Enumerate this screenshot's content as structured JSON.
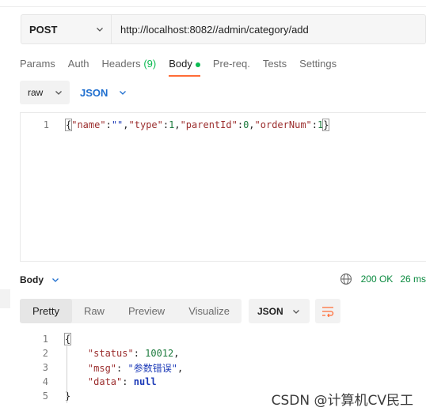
{
  "request": {
    "method": "POST",
    "url": "http://localhost:8082//admin/category/add"
  },
  "tabs": [
    {
      "label": "Params"
    },
    {
      "label": "Auth"
    },
    {
      "label": "Headers",
      "count": "(9)"
    },
    {
      "label": "Body"
    },
    {
      "label": "Pre-req."
    },
    {
      "label": "Tests"
    },
    {
      "label": "Settings"
    }
  ],
  "body_options": {
    "mode": "raw",
    "format": "JSON"
  },
  "editor": {
    "line_number": "1",
    "tokens": [
      "{",
      "\"name\"",
      ":",
      "\"\"",
      ",",
      "\"type\"",
      ":",
      "1",
      ",",
      "\"parentId\"",
      ":",
      "0",
      ",",
      "\"orderNum\"",
      ":",
      "1",
      "}"
    ]
  },
  "response": {
    "body_label": "Body",
    "status": "200 OK",
    "time": "26 ms",
    "view_tabs": [
      "Pretty",
      "Raw",
      "Preview",
      "Visualize"
    ],
    "format": "JSON",
    "lines": [
      {
        "n": "1",
        "text": "{"
      },
      {
        "n": "2",
        "key": "\"status\"",
        "value": "10012",
        "trail": ","
      },
      {
        "n": "3",
        "key": "\"msg\"",
        "value": "\"参数错误\"",
        "trail": ","
      },
      {
        "n": "4",
        "key": "\"data\"",
        "value": "null",
        "trail": ""
      },
      {
        "n": "5",
        "text": "}"
      }
    ]
  },
  "watermark": "CSDN @计算机CV民工",
  "colors": {
    "accent": "#ff6c37",
    "success": "#0cbb52",
    "link": "#1f6fcf"
  }
}
